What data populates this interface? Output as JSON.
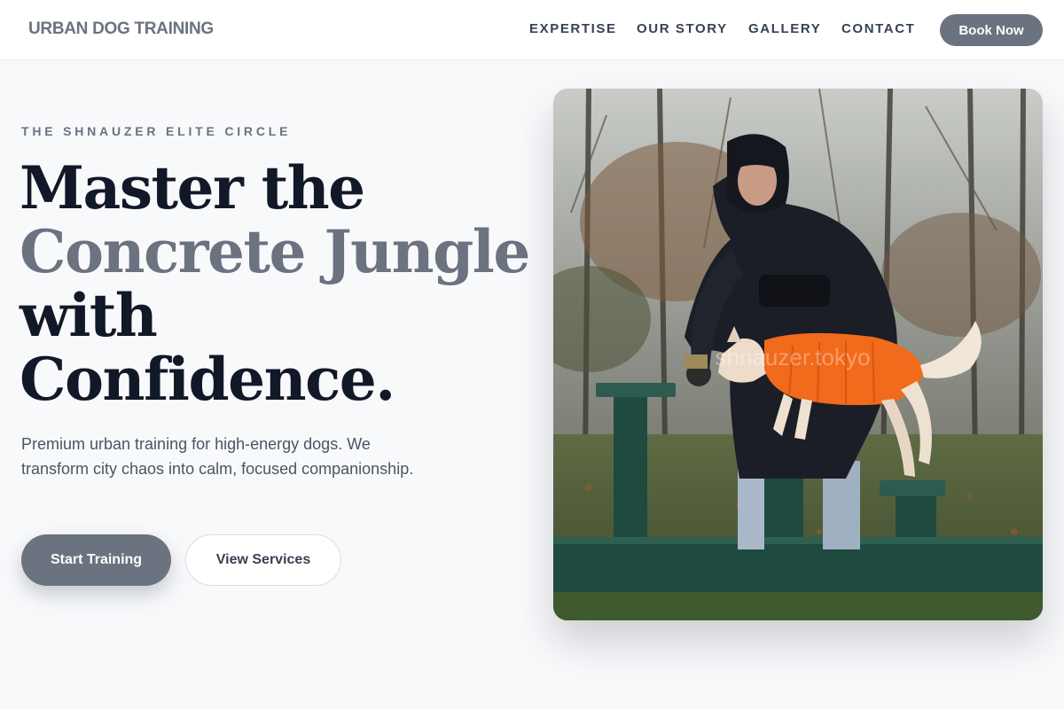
{
  "header": {
    "brand": "URBAN DOG TRAINING",
    "nav": [
      "EXPERTISE",
      "OUR STORY",
      "GALLERY",
      "CONTACT"
    ],
    "cta_label": "Book Now"
  },
  "hero": {
    "eyebrow": "THE SHNAUZER ELITE CIRCLE",
    "headline": {
      "line1": "Master the",
      "line2": "Concrete Jungle",
      "line3": "with",
      "line4": "Confidence."
    },
    "lede": "Premium urban training for high-energy dogs. We transform city chaos into calm, focused companionship.",
    "primary_cta": "Start Training",
    "secondary_cta": "View Services",
    "photo": {
      "watermark": "shnauzer.tokyo",
      "icon": "dog-training-photo"
    }
  },
  "colors": {
    "accent": "#6b7280",
    "heading": "#111827",
    "background": "#f8f9fb",
    "dog_coat": "#f26a1b"
  }
}
